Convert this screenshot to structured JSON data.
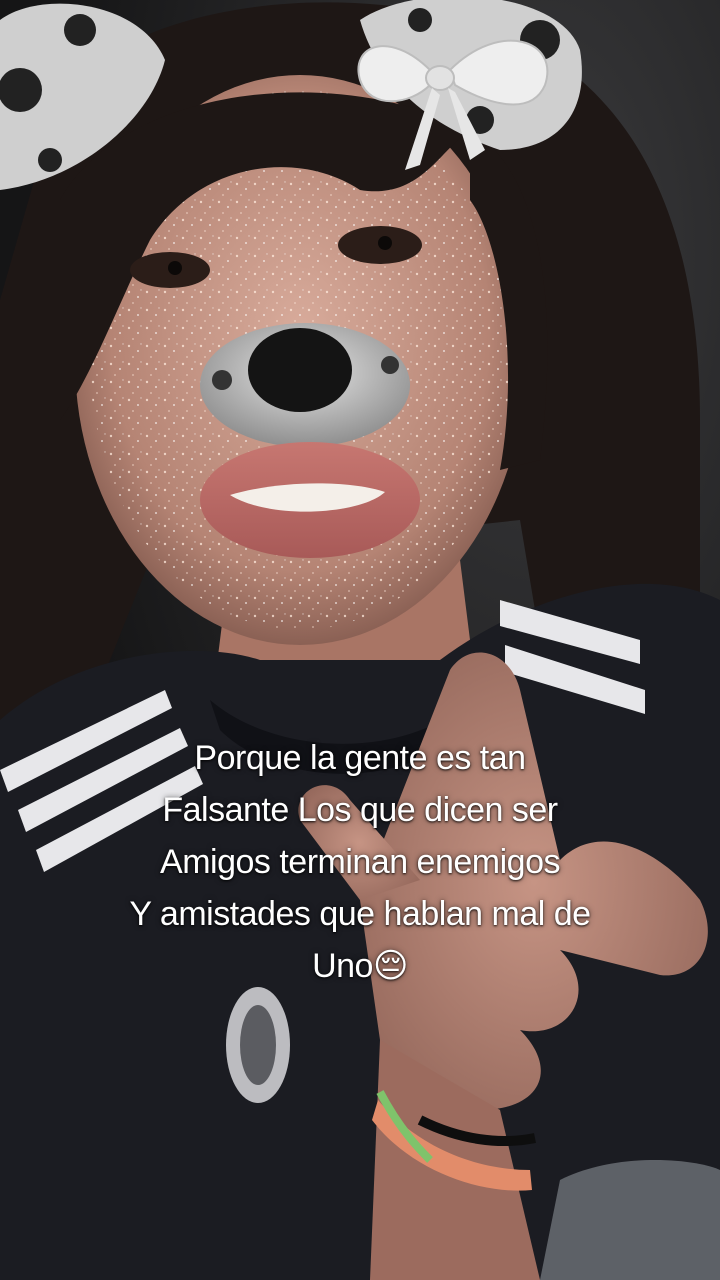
{
  "scene": {
    "description_icons": [
      "dog-ears-filter-icon",
      "bow-icon",
      "dog-nose-filter-icon"
    ],
    "colors": {
      "background": "#1b1b1c",
      "skin": "#c99a8a",
      "hair": "#1e1715",
      "jersey": "#1b1c22",
      "stripe": "#e7e7ea",
      "ear_spot": "#222222",
      "filter_white": "#d9d9d9",
      "caption_text": "#ffffff"
    }
  },
  "caption": {
    "line1": "Porque la gente es tan",
    "line2": "Falsante Los que dicen ser",
    "line3": "Amigos terminan enemigos",
    "line4": "Y amistades que hablan mal de",
    "line5": "Uno😔"
  }
}
